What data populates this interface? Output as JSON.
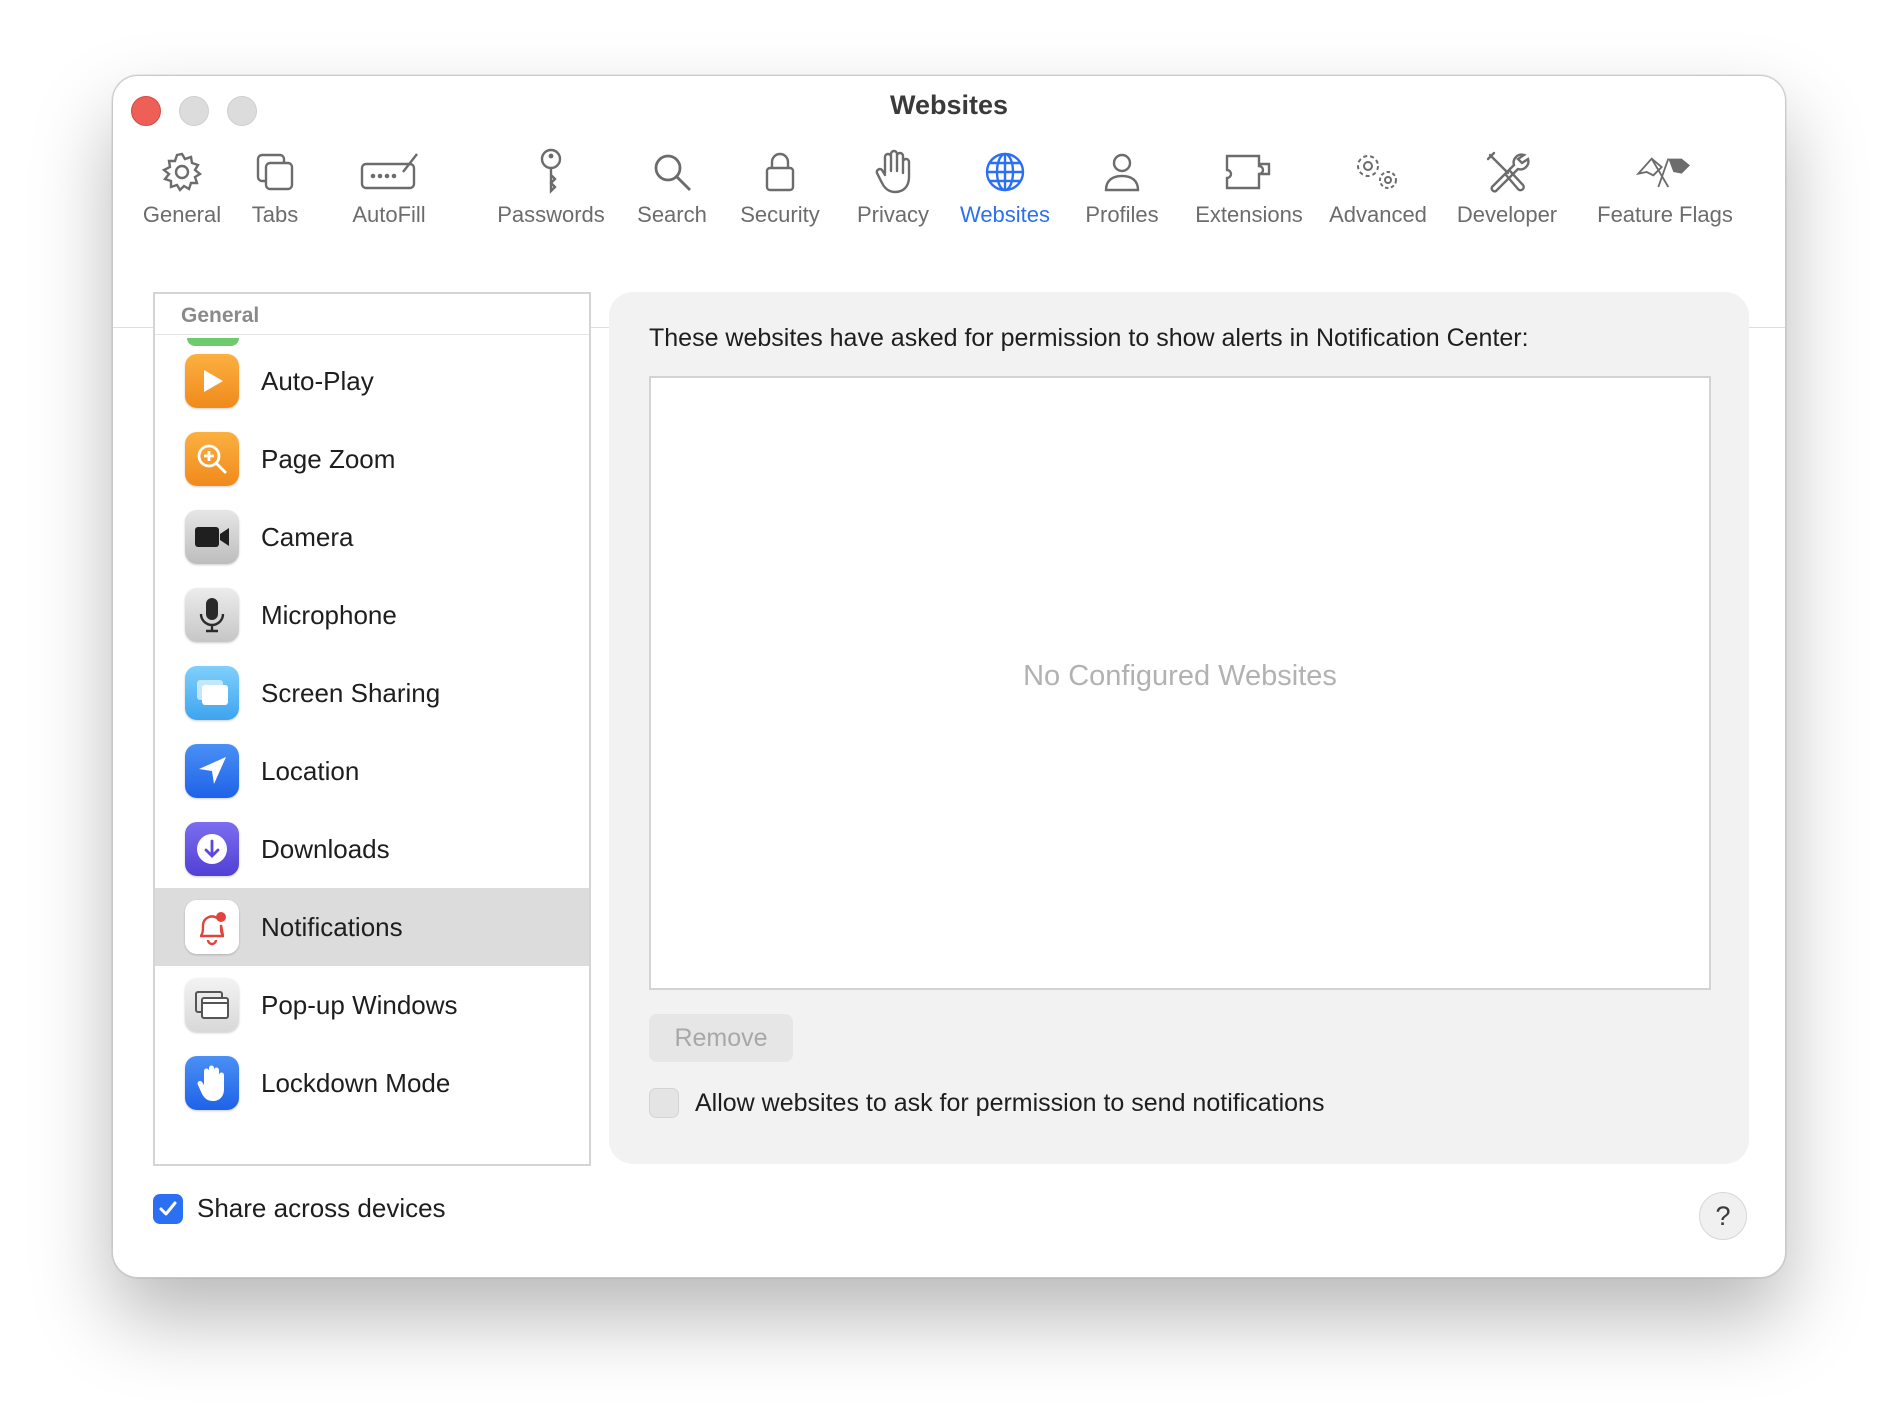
{
  "window": {
    "title": "Websites"
  },
  "toolbar": {
    "items": [
      {
        "label": "General",
        "icon": "gear-icon"
      },
      {
        "label": "Tabs",
        "icon": "tabs-icon"
      },
      {
        "label": "AutoFill",
        "icon": "autofill-icon"
      },
      {
        "label": "Passwords",
        "icon": "key-icon"
      },
      {
        "label": "Search",
        "icon": "search-icon"
      },
      {
        "label": "Security",
        "icon": "lock-icon"
      },
      {
        "label": "Privacy",
        "icon": "hand-icon"
      },
      {
        "label": "Websites",
        "icon": "globe-icon",
        "active": true
      },
      {
        "label": "Profiles",
        "icon": "person-icon"
      },
      {
        "label": "Extensions",
        "icon": "puzzle-icon"
      },
      {
        "label": "Advanced",
        "icon": "gears-icon"
      },
      {
        "label": "Developer",
        "icon": "tools-icon"
      },
      {
        "label": "Feature Flags",
        "icon": "flags-icon"
      }
    ],
    "active_color": "#2b6ff2"
  },
  "sidebar": {
    "header": "General",
    "items": [
      {
        "label": "Auto-Play",
        "icon": "play-icon",
        "color": "#f39a2a"
      },
      {
        "label": "Page Zoom",
        "icon": "zoom-icon",
        "color": "#f39a2a"
      },
      {
        "label": "Camera",
        "icon": "camera-icon",
        "color": "#5e5e5e"
      },
      {
        "label": "Microphone",
        "icon": "microphone-icon",
        "color": "#c8c8c8"
      },
      {
        "label": "Screen Sharing",
        "icon": "screen-sharing-icon",
        "color": "#5ab8f3"
      },
      {
        "label": "Location",
        "icon": "location-arrow-icon",
        "color": "#2b74f0"
      },
      {
        "label": "Downloads",
        "icon": "download-icon",
        "color": "#6a56e0"
      },
      {
        "label": "Notifications",
        "icon": "bell-icon",
        "color": "#ffffff",
        "selected": true
      },
      {
        "label": "Pop-up Windows",
        "icon": "popup-window-icon",
        "color": "#e8e8e8"
      },
      {
        "label": "Lockdown Mode",
        "icon": "raised-hand-icon",
        "color": "#2b74f0"
      }
    ]
  },
  "panel": {
    "description": "These websites have asked for permission to show alerts in Notification Center:",
    "empty_text": "No Configured Websites",
    "remove_label": "Remove",
    "allow_label": "Allow websites to ask for permission to send notifications",
    "allow_checked": false
  },
  "footer": {
    "share_label": "Share across devices",
    "share_checked": true,
    "help_label": "?"
  }
}
